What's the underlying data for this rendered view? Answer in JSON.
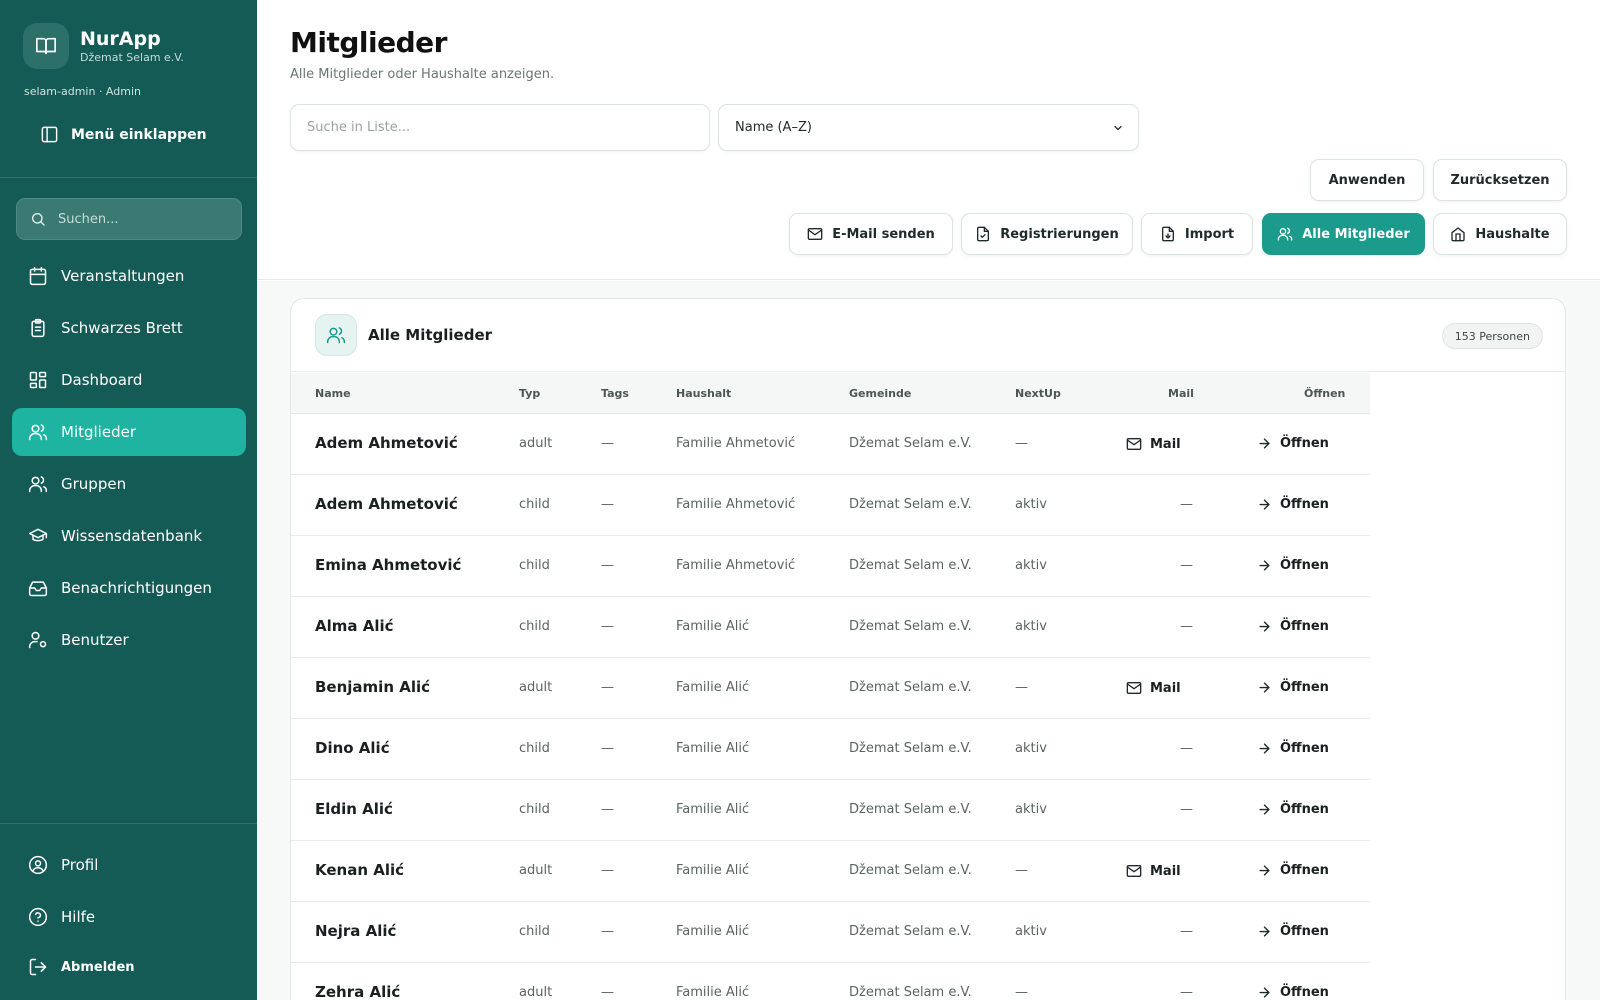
{
  "sidebar": {
    "app_name": "NurApp",
    "org_name": "Džemat Selam e.V.",
    "user_line": "selam-admin · Admin",
    "collapse_label": "Menü einklappen",
    "search_placeholder": "Suchen...",
    "nav_items": [
      {
        "label": "Veranstaltungen",
        "icon": "calendar-icon"
      },
      {
        "label": "Schwarzes Brett",
        "icon": "clipboard-icon"
      },
      {
        "label": "Dashboard",
        "icon": "dashboard-grid-icon"
      },
      {
        "label": "Mitglieder",
        "icon": "users-icon",
        "active": true
      },
      {
        "label": "Gruppen",
        "icon": "users-group-icon"
      },
      {
        "label": "Wissensdatenbank",
        "icon": "graduation-cap-icon"
      },
      {
        "label": "Benachrichtigungen",
        "icon": "inbox-icon"
      },
      {
        "label": "Benutzer",
        "icon": "user-cog-icon"
      }
    ],
    "bottom_items": [
      {
        "label": "Profil",
        "icon": "user-circle-icon"
      },
      {
        "label": "Hilfe",
        "icon": "help-circle-icon"
      },
      {
        "label": "Abmelden",
        "icon": "logout-icon"
      }
    ]
  },
  "header": {
    "title": "Mitglieder",
    "subtitle": "Alle Mitglieder oder Haushalte anzeigen.",
    "list_search_placeholder": "Suche in Liste...",
    "sort_value": "Name (A–Z)",
    "apply_label": "Anwenden",
    "reset_label": "Zurücksetzen",
    "actions": {
      "email": "E-Mail senden",
      "registrations": "Registrierungen",
      "import": "Import",
      "all_members": "Alle Mitglieder",
      "households": "Haushalte"
    }
  },
  "card": {
    "title": "Alle Mitglieder",
    "count": "153 Personen",
    "columns": [
      "Name",
      "Typ",
      "Tags",
      "Haushalt",
      "Gemeinde",
      "NextUp",
      "Mail",
      "Öffnen"
    ],
    "open_label": "Öffnen",
    "mail_label": "Mail",
    "rows": [
      {
        "name": "Adem Ahmetović",
        "type": "adult",
        "tags": "—",
        "household": "Familie Ahmetović",
        "community": "Džemat Selam e.V.",
        "nextup": "—",
        "mail": "Mail"
      },
      {
        "name": "Adem Ahmetović",
        "type": "child",
        "tags": "—",
        "household": "Familie Ahmetović",
        "community": "Džemat Selam e.V.",
        "nextup": "aktiv",
        "mail": "—"
      },
      {
        "name": "Emina Ahmetović",
        "type": "child",
        "tags": "—",
        "household": "Familie Ahmetović",
        "community": "Džemat Selam e.V.",
        "nextup": "aktiv",
        "mail": "—"
      },
      {
        "name": "Alma Alić",
        "type": "child",
        "tags": "—",
        "household": "Familie Alić",
        "community": "Džemat Selam e.V.",
        "nextup": "aktiv",
        "mail": "—"
      },
      {
        "name": "Benjamin Alić",
        "type": "adult",
        "tags": "—",
        "household": "Familie Alić",
        "community": "Džemat Selam e.V.",
        "nextup": "—",
        "mail": "Mail"
      },
      {
        "name": "Dino Alić",
        "type": "child",
        "tags": "—",
        "household": "Familie Alić",
        "community": "Džemat Selam e.V.",
        "nextup": "aktiv",
        "mail": "—"
      },
      {
        "name": "Eldin Alić",
        "type": "child",
        "tags": "—",
        "household": "Familie Alić",
        "community": "Džemat Selam e.V.",
        "nextup": "aktiv",
        "mail": "—"
      },
      {
        "name": "Kenan Alić",
        "type": "adult",
        "tags": "—",
        "household": "Familie Alić",
        "community": "Džemat Selam e.V.",
        "nextup": "—",
        "mail": "Mail"
      },
      {
        "name": "Nejra Alić",
        "type": "child",
        "tags": "—",
        "household": "Familie Alić",
        "community": "Džemat Selam e.V.",
        "nextup": "aktiv",
        "mail": "—"
      },
      {
        "name": "Zehra Alić",
        "type": "adult",
        "tags": "—",
        "household": "Familie Alić",
        "community": "Džemat Selam e.V.",
        "nextup": "—",
        "mail": "—"
      }
    ]
  },
  "colors": {
    "sidebar_bg": "#155b55",
    "active_nav": "#1fb3a1",
    "primary_button": "#1a9b8c"
  }
}
